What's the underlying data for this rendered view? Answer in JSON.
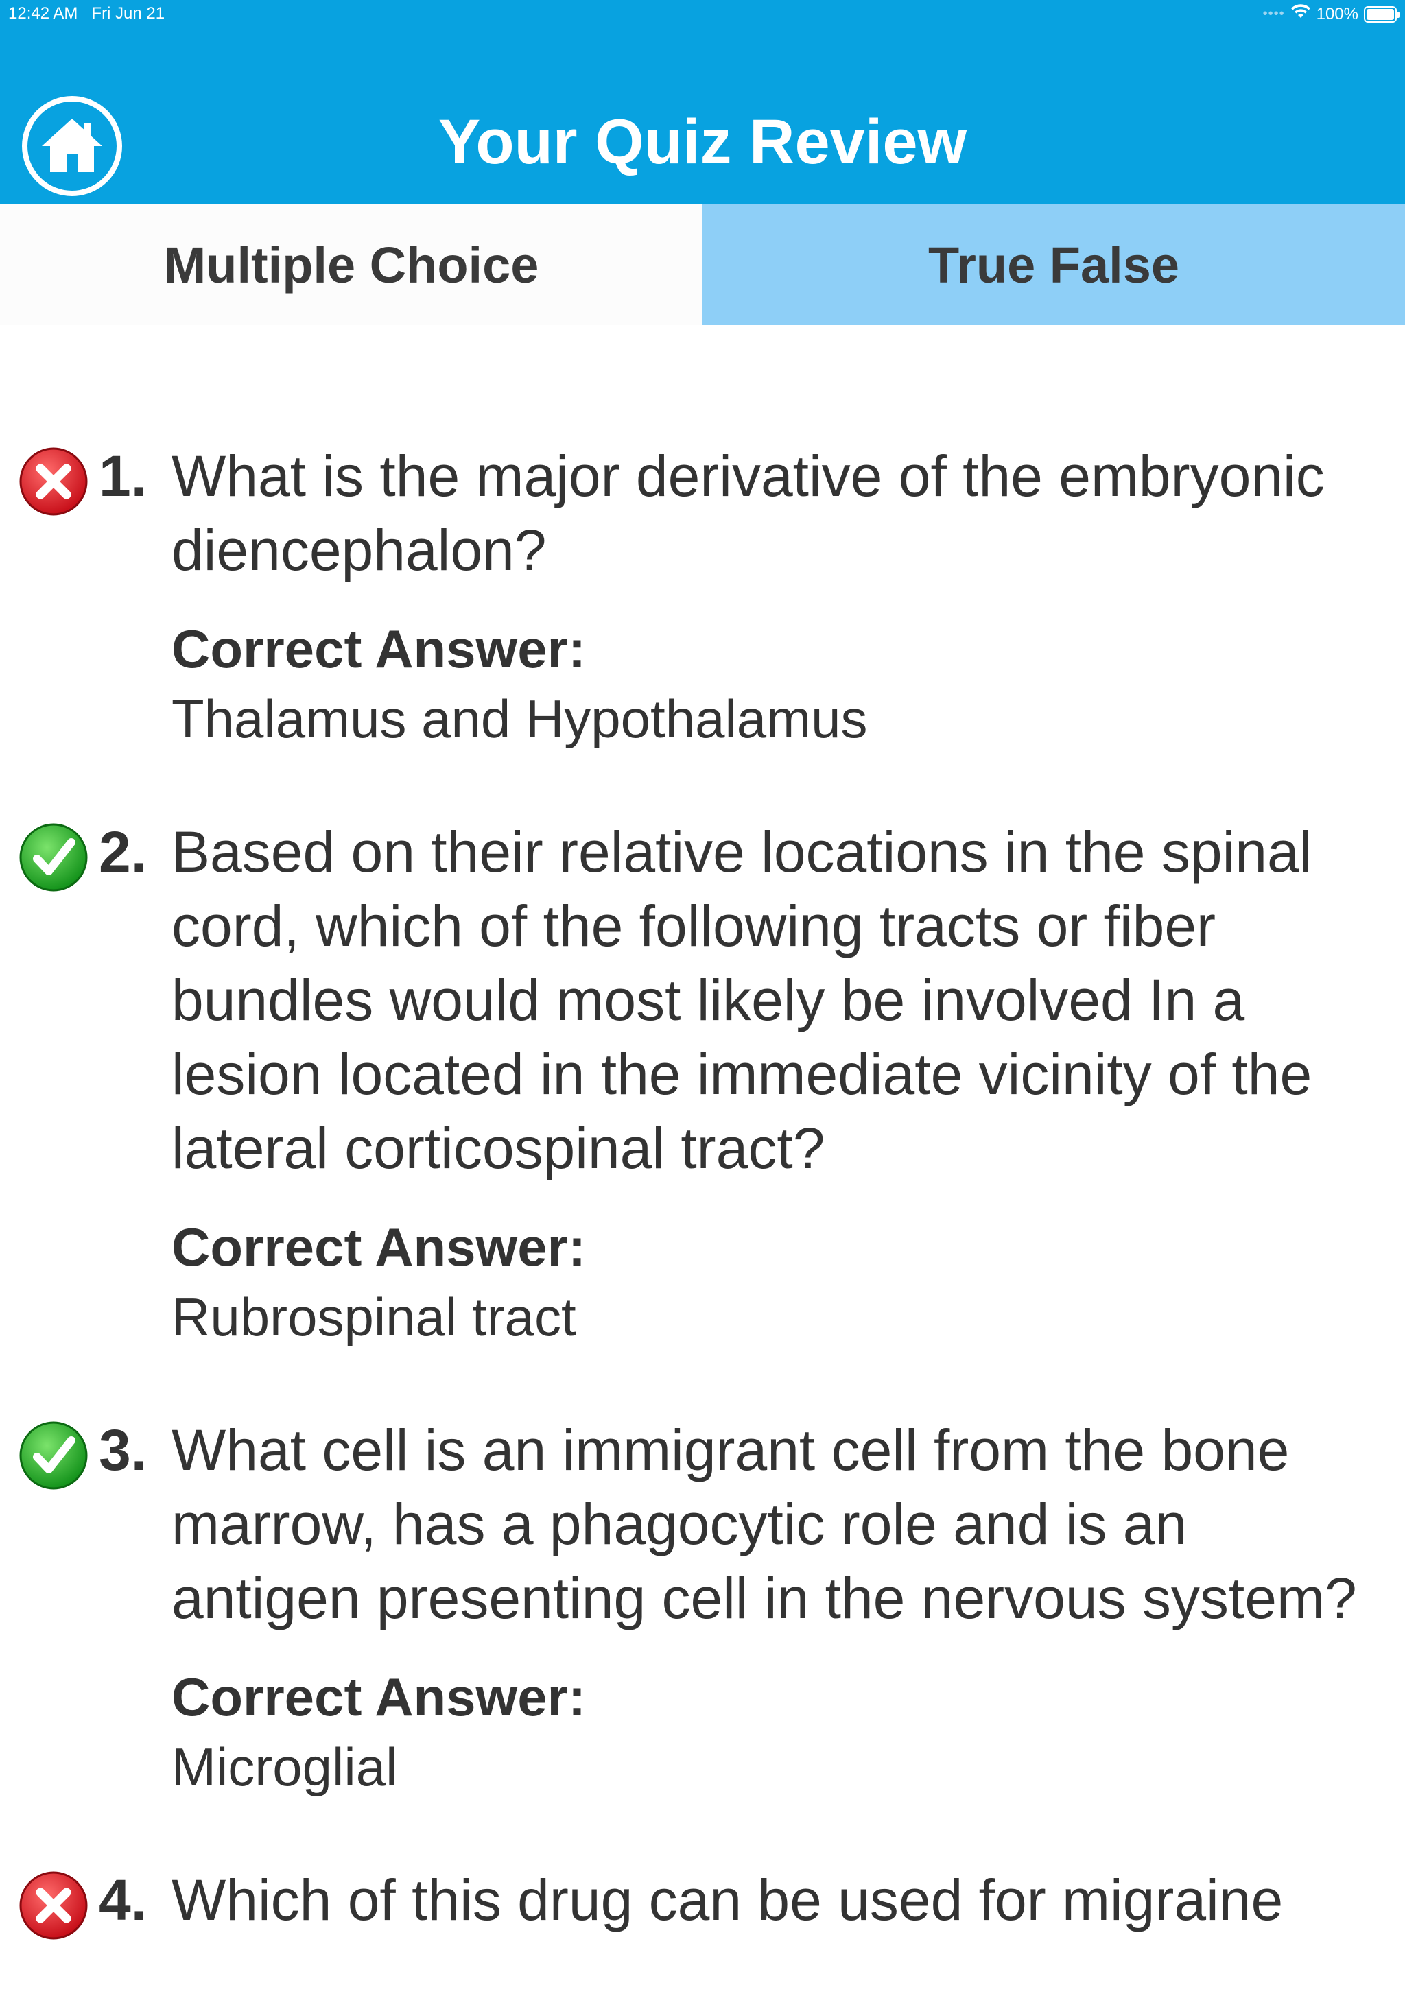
{
  "status_bar": {
    "time": "12:42 AM",
    "date": "Fri Jun 21",
    "battery": "100%",
    "wifi_icon": "wifi-icon",
    "battery_icon": "battery-icon"
  },
  "header": {
    "title": "Your Quiz Review",
    "home_icon": "home-icon",
    "background_color": "#08a2e0"
  },
  "tabs": [
    {
      "label": "Multiple Choice",
      "selected": true
    },
    {
      "label": "True False",
      "selected": false
    }
  ],
  "answer_label": "Correct Answer:",
  "questions": [
    {
      "number": "1.",
      "correct": false,
      "status_icon": "wrong-icon",
      "question": "What is the major derivative of the embryonic diencephalon?",
      "answer": "Thalamus and Hypothalamus"
    },
    {
      "number": "2.",
      "correct": true,
      "status_icon": "check-icon",
      "question": "Based on their relative locations in the spinal cord, which of the following tracts or fiber bundles would most likely be involved In a lesion located in the immediate vicinity of the lateral corticospinal tract?",
      "answer": "Rubrospinal tract"
    },
    {
      "number": "3.",
      "correct": true,
      "status_icon": "check-icon",
      "question": "What cell is an immigrant cell from the bone marrow, has a phagocytic role and is an antigen presenting cell in the nervous system?",
      "answer": "Microglial"
    },
    {
      "number": "4.",
      "correct": false,
      "status_icon": "wrong-icon",
      "question": "Which of this drug can be used for migraine",
      "answer": ""
    }
  ]
}
